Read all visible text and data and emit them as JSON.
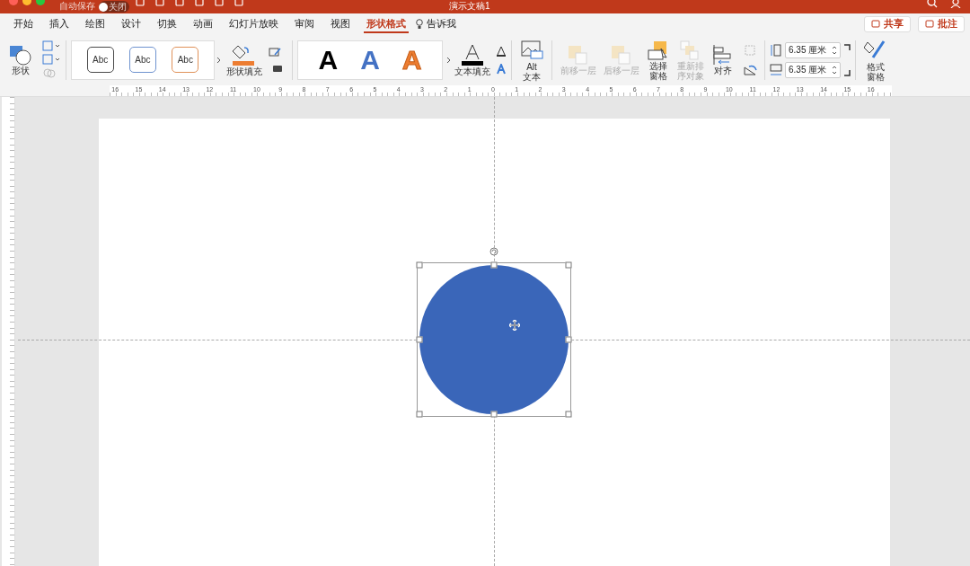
{
  "title_bar": {
    "autosave_label": "自动保存",
    "autosave_toggle": {
      "on": false,
      "label": "关闭"
    },
    "title": "演示文稿1"
  },
  "tabs": [
    {
      "label": "开始",
      "selected": false
    },
    {
      "label": "插入",
      "selected": false
    },
    {
      "label": "绘图",
      "selected": false
    },
    {
      "label": "设计",
      "selected": false
    },
    {
      "label": "切换",
      "selected": false
    },
    {
      "label": "动画",
      "selected": false
    },
    {
      "label": "幻灯片放映",
      "selected": false
    },
    {
      "label": "审阅",
      "selected": false
    },
    {
      "label": "视图",
      "selected": false
    },
    {
      "label": "形状格式",
      "selected": true
    }
  ],
  "tell_me": "告诉我",
  "share_button": "共享",
  "comments_button": "批注",
  "ribbon": {
    "shape_label": "形状",
    "shape_styles": [
      {
        "label": "Abc",
        "color": "#4a4a4a"
      },
      {
        "label": "Abc",
        "color": "#6f93cf"
      },
      {
        "label": "Abc",
        "color": "#e0925a"
      }
    ],
    "shape_fill_label": "形状填充",
    "wordart": [
      {
        "label": "A",
        "color": "#000000"
      },
      {
        "label": "A",
        "color": "#4472c4"
      },
      {
        "label": "A",
        "color": "#ed7d31"
      }
    ],
    "text_fill_label": "文本填充",
    "alt_text": [
      "Alt",
      "文本"
    ],
    "arrange": [
      {
        "lines": [
          "前移一层"
        ],
        "disabled": true,
        "kind": "forward"
      },
      {
        "lines": [
          "后移一层"
        ],
        "disabled": true,
        "kind": "backward"
      },
      {
        "lines": [
          "选择",
          "窗格"
        ],
        "disabled": false,
        "kind": "pane"
      },
      {
        "lines": [
          "重新排",
          "序对象"
        ],
        "disabled": true,
        "kind": "reorder"
      },
      {
        "lines": [
          "对齐"
        ],
        "disabled": false,
        "kind": "align"
      }
    ],
    "height": "6.35 厘米",
    "width": "6.35 厘米",
    "format_pane": [
      "格式",
      "窗格"
    ]
  },
  "ruler": [
    "16",
    "15",
    "14",
    "13",
    "12",
    "11",
    "10",
    "9",
    "8",
    "7",
    "6",
    "5",
    "4",
    "3",
    "2",
    "1",
    "0",
    "1",
    "2",
    "3",
    "4",
    "5",
    "6",
    "7",
    "8",
    "9",
    "10",
    "11",
    "12",
    "13",
    "14",
    "15",
    "16"
  ],
  "shape": {
    "kind": "circle",
    "color": "#3a66b9",
    "selected": true
  }
}
